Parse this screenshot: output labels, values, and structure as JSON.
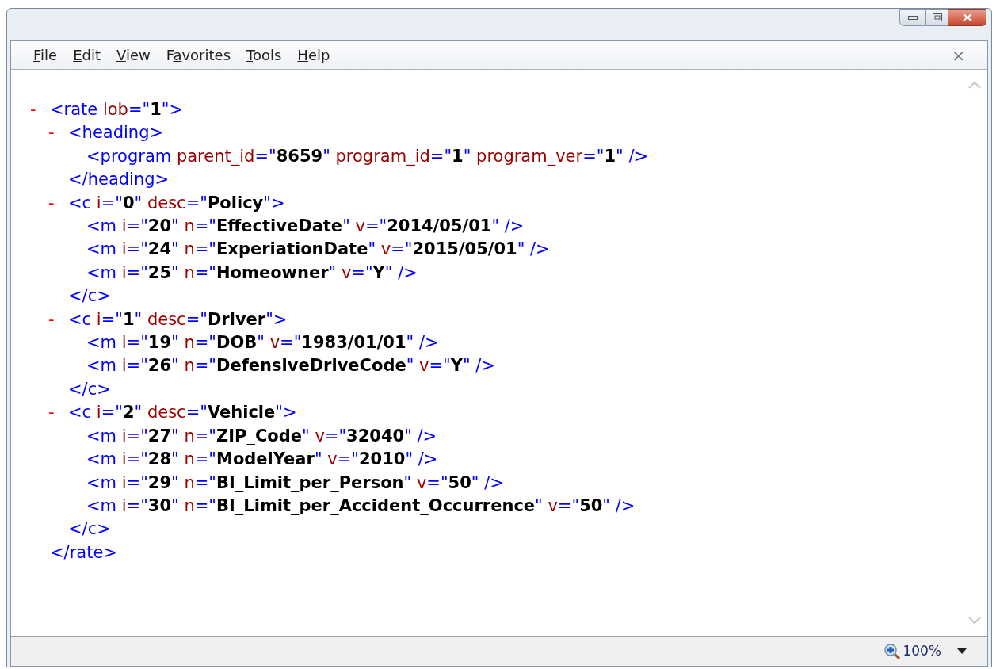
{
  "menu": [
    {
      "accel": "F",
      "rest": "ile"
    },
    {
      "accel": "E",
      "rest": "dit"
    },
    {
      "accel": "V",
      "rest": "iew"
    },
    {
      "pre": "F",
      "accel": "a",
      "rest": "vorites"
    },
    {
      "accel": "T",
      "rest": "ools"
    },
    {
      "accel": "H",
      "rest": "elp"
    }
  ],
  "menu_close": "×",
  "document": [
    {
      "toggle": "-",
      "segments": [
        {
          "kind": "tag",
          "text": "<rate"
        },
        {
          "kind": "attr",
          "text": " lob"
        },
        {
          "kind": "punct",
          "text": "=\""
        },
        {
          "kind": "value",
          "text": "1"
        },
        {
          "kind": "punct",
          "text": "\">"
        }
      ],
      "closing": [
        {
          "kind": "tag",
          "text": "</rate>"
        }
      ],
      "children": [
        {
          "toggle": "-",
          "segments": [
            {
              "kind": "tag",
              "text": "<heading>"
            }
          ],
          "closing": [
            {
              "kind": "tag",
              "text": "</heading>"
            }
          ],
          "children": [
            {
              "segments": [
                {
                  "kind": "tag",
                  "text": "<program"
                },
                {
                  "kind": "attr",
                  "text": " parent_id"
                },
                {
                  "kind": "punct",
                  "text": "=\""
                },
                {
                  "kind": "value",
                  "text": "8659"
                },
                {
                  "kind": "punct",
                  "text": "\""
                },
                {
                  "kind": "attr",
                  "text": " program_id"
                },
                {
                  "kind": "punct",
                  "text": "=\""
                },
                {
                  "kind": "value",
                  "text": "1"
                },
                {
                  "kind": "punct",
                  "text": "\""
                },
                {
                  "kind": "attr",
                  "text": " program_ver"
                },
                {
                  "kind": "punct",
                  "text": "=\""
                },
                {
                  "kind": "value",
                  "text": "1"
                },
                {
                  "kind": "punct",
                  "text": "\" />"
                }
              ]
            }
          ]
        },
        {
          "toggle": "-",
          "segments": [
            {
              "kind": "tag",
              "text": "<c"
            },
            {
              "kind": "attr",
              "text": " i"
            },
            {
              "kind": "punct",
              "text": "=\""
            },
            {
              "kind": "value",
              "text": "0"
            },
            {
              "kind": "punct",
              "text": "\""
            },
            {
              "kind": "attr",
              "text": " desc"
            },
            {
              "kind": "punct",
              "text": "=\""
            },
            {
              "kind": "value",
              "text": "Policy"
            },
            {
              "kind": "punct",
              "text": "\">"
            }
          ],
          "closing": [
            {
              "kind": "tag",
              "text": "</c>"
            }
          ],
          "children": [
            {
              "segments": [
                {
                  "kind": "tag",
                  "text": "<m"
                },
                {
                  "kind": "attr",
                  "text": " i"
                },
                {
                  "kind": "punct",
                  "text": "=\""
                },
                {
                  "kind": "value",
                  "text": "20"
                },
                {
                  "kind": "punct",
                  "text": "\""
                },
                {
                  "kind": "attr",
                  "text": " n"
                },
                {
                  "kind": "punct",
                  "text": "=\""
                },
                {
                  "kind": "value",
                  "text": "EffectiveDate"
                },
                {
                  "kind": "punct",
                  "text": "\""
                },
                {
                  "kind": "attr",
                  "text": " v"
                },
                {
                  "kind": "punct",
                  "text": "=\""
                },
                {
                  "kind": "value",
                  "text": "2014/05/01"
                },
                {
                  "kind": "punct",
                  "text": "\" />"
                }
              ]
            },
            {
              "segments": [
                {
                  "kind": "tag",
                  "text": "<m"
                },
                {
                  "kind": "attr",
                  "text": " i"
                },
                {
                  "kind": "punct",
                  "text": "=\""
                },
                {
                  "kind": "value",
                  "text": "24"
                },
                {
                  "kind": "punct",
                  "text": "\""
                },
                {
                  "kind": "attr",
                  "text": " n"
                },
                {
                  "kind": "punct",
                  "text": "=\""
                },
                {
                  "kind": "value",
                  "text": "ExperiationDate"
                },
                {
                  "kind": "punct",
                  "text": "\""
                },
                {
                  "kind": "attr",
                  "text": " v"
                },
                {
                  "kind": "punct",
                  "text": "=\""
                },
                {
                  "kind": "value",
                  "text": "2015/05/01"
                },
                {
                  "kind": "punct",
                  "text": "\" />"
                }
              ]
            },
            {
              "segments": [
                {
                  "kind": "tag",
                  "text": "<m"
                },
                {
                  "kind": "attr",
                  "text": " i"
                },
                {
                  "kind": "punct",
                  "text": "=\""
                },
                {
                  "kind": "value",
                  "text": "25"
                },
                {
                  "kind": "punct",
                  "text": "\""
                },
                {
                  "kind": "attr",
                  "text": " n"
                },
                {
                  "kind": "punct",
                  "text": "=\""
                },
                {
                  "kind": "value",
                  "text": "Homeowner"
                },
                {
                  "kind": "punct",
                  "text": "\""
                },
                {
                  "kind": "attr",
                  "text": " v"
                },
                {
                  "kind": "punct",
                  "text": "=\""
                },
                {
                  "kind": "value",
                  "text": "Y"
                },
                {
                  "kind": "punct",
                  "text": "\" />"
                }
              ]
            }
          ]
        },
        {
          "toggle": "-",
          "segments": [
            {
              "kind": "tag",
              "text": "<c"
            },
            {
              "kind": "attr",
              "text": " i"
            },
            {
              "kind": "punct",
              "text": "=\""
            },
            {
              "kind": "value",
              "text": "1"
            },
            {
              "kind": "punct",
              "text": "\""
            },
            {
              "kind": "attr",
              "text": " desc"
            },
            {
              "kind": "punct",
              "text": "=\""
            },
            {
              "kind": "value",
              "text": "Driver"
            },
            {
              "kind": "punct",
              "text": "\">"
            }
          ],
          "closing": [
            {
              "kind": "tag",
              "text": "</c>"
            }
          ],
          "children": [
            {
              "segments": [
                {
                  "kind": "tag",
                  "text": "<m"
                },
                {
                  "kind": "attr",
                  "text": " i"
                },
                {
                  "kind": "punct",
                  "text": "=\""
                },
                {
                  "kind": "value",
                  "text": "19"
                },
                {
                  "kind": "punct",
                  "text": "\""
                },
                {
                  "kind": "attr",
                  "text": " n"
                },
                {
                  "kind": "punct",
                  "text": "=\""
                },
                {
                  "kind": "value",
                  "text": "DOB"
                },
                {
                  "kind": "punct",
                  "text": "\""
                },
                {
                  "kind": "attr",
                  "text": " v"
                },
                {
                  "kind": "punct",
                  "text": "=\""
                },
                {
                  "kind": "value",
                  "text": "1983/01/01"
                },
                {
                  "kind": "punct",
                  "text": "\" />"
                }
              ]
            },
            {
              "segments": [
                {
                  "kind": "tag",
                  "text": "<m"
                },
                {
                  "kind": "attr",
                  "text": " i"
                },
                {
                  "kind": "punct",
                  "text": "=\""
                },
                {
                  "kind": "value",
                  "text": "26"
                },
                {
                  "kind": "punct",
                  "text": "\""
                },
                {
                  "kind": "attr",
                  "text": " n"
                },
                {
                  "kind": "punct",
                  "text": "=\""
                },
                {
                  "kind": "value",
                  "text": "DefensiveDriveCode"
                },
                {
                  "kind": "punct",
                  "text": "\""
                },
                {
                  "kind": "attr",
                  "text": " v"
                },
                {
                  "kind": "punct",
                  "text": "=\""
                },
                {
                  "kind": "value",
                  "text": "Y"
                },
                {
                  "kind": "punct",
                  "text": "\" />"
                }
              ]
            }
          ]
        },
        {
          "toggle": "-",
          "segments": [
            {
              "kind": "tag",
              "text": "<c"
            },
            {
              "kind": "attr",
              "text": " i"
            },
            {
              "kind": "punct",
              "text": "=\""
            },
            {
              "kind": "value",
              "text": "2"
            },
            {
              "kind": "punct",
              "text": "\""
            },
            {
              "kind": "attr",
              "text": " desc"
            },
            {
              "kind": "punct",
              "text": "=\""
            },
            {
              "kind": "value",
              "text": "Vehicle"
            },
            {
              "kind": "punct",
              "text": "\">"
            }
          ],
          "closing": [
            {
              "kind": "tag",
              "text": "</c>"
            }
          ],
          "children": [
            {
              "segments": [
                {
                  "kind": "tag",
                  "text": "<m"
                },
                {
                  "kind": "attr",
                  "text": " i"
                },
                {
                  "kind": "punct",
                  "text": "=\""
                },
                {
                  "kind": "value",
                  "text": "27"
                },
                {
                  "kind": "punct",
                  "text": "\""
                },
                {
                  "kind": "attr",
                  "text": " n"
                },
                {
                  "kind": "punct",
                  "text": "=\""
                },
                {
                  "kind": "value",
                  "text": "ZIP_Code"
                },
                {
                  "kind": "punct",
                  "text": "\""
                },
                {
                  "kind": "attr",
                  "text": " v"
                },
                {
                  "kind": "punct",
                  "text": "=\""
                },
                {
                  "kind": "value",
                  "text": "32040"
                },
                {
                  "kind": "punct",
                  "text": "\" />"
                }
              ]
            },
            {
              "segments": [
                {
                  "kind": "tag",
                  "text": "<m"
                },
                {
                  "kind": "attr",
                  "text": " i"
                },
                {
                  "kind": "punct",
                  "text": "=\""
                },
                {
                  "kind": "value",
                  "text": "28"
                },
                {
                  "kind": "punct",
                  "text": "\""
                },
                {
                  "kind": "attr",
                  "text": " n"
                },
                {
                  "kind": "punct",
                  "text": "=\""
                },
                {
                  "kind": "value",
                  "text": "ModelYear"
                },
                {
                  "kind": "punct",
                  "text": "\""
                },
                {
                  "kind": "attr",
                  "text": " v"
                },
                {
                  "kind": "punct",
                  "text": "=\""
                },
                {
                  "kind": "value",
                  "text": "2010"
                },
                {
                  "kind": "punct",
                  "text": "\" />"
                }
              ]
            },
            {
              "segments": [
                {
                  "kind": "tag",
                  "text": "<m"
                },
                {
                  "kind": "attr",
                  "text": " i"
                },
                {
                  "kind": "punct",
                  "text": "=\""
                },
                {
                  "kind": "value",
                  "text": "29"
                },
                {
                  "kind": "punct",
                  "text": "\""
                },
                {
                  "kind": "attr",
                  "text": " n"
                },
                {
                  "kind": "punct",
                  "text": "=\""
                },
                {
                  "kind": "value",
                  "text": "BI_Limit_per_Person"
                },
                {
                  "kind": "punct",
                  "text": "\""
                },
                {
                  "kind": "attr",
                  "text": " v"
                },
                {
                  "kind": "punct",
                  "text": "=\""
                },
                {
                  "kind": "value",
                  "text": "50"
                },
                {
                  "kind": "punct",
                  "text": "\" />"
                }
              ]
            },
            {
              "segments": [
                {
                  "kind": "tag",
                  "text": "<m"
                },
                {
                  "kind": "attr",
                  "text": " i"
                },
                {
                  "kind": "punct",
                  "text": "=\""
                },
                {
                  "kind": "value",
                  "text": "30"
                },
                {
                  "kind": "punct",
                  "text": "\""
                },
                {
                  "kind": "attr",
                  "text": " n"
                },
                {
                  "kind": "punct",
                  "text": "=\""
                },
                {
                  "kind": "value",
                  "text": "BI_Limit_per_Accident_Occurrence"
                },
                {
                  "kind": "punct",
                  "text": "\""
                },
                {
                  "kind": "attr",
                  "text": " v"
                },
                {
                  "kind": "punct",
                  "text": "=\""
                },
                {
                  "kind": "value",
                  "text": "50"
                },
                {
                  "kind": "punct",
                  "text": "\" />"
                }
              ]
            }
          ]
        }
      ]
    }
  ],
  "status_bar": {
    "zoom": "100%"
  }
}
